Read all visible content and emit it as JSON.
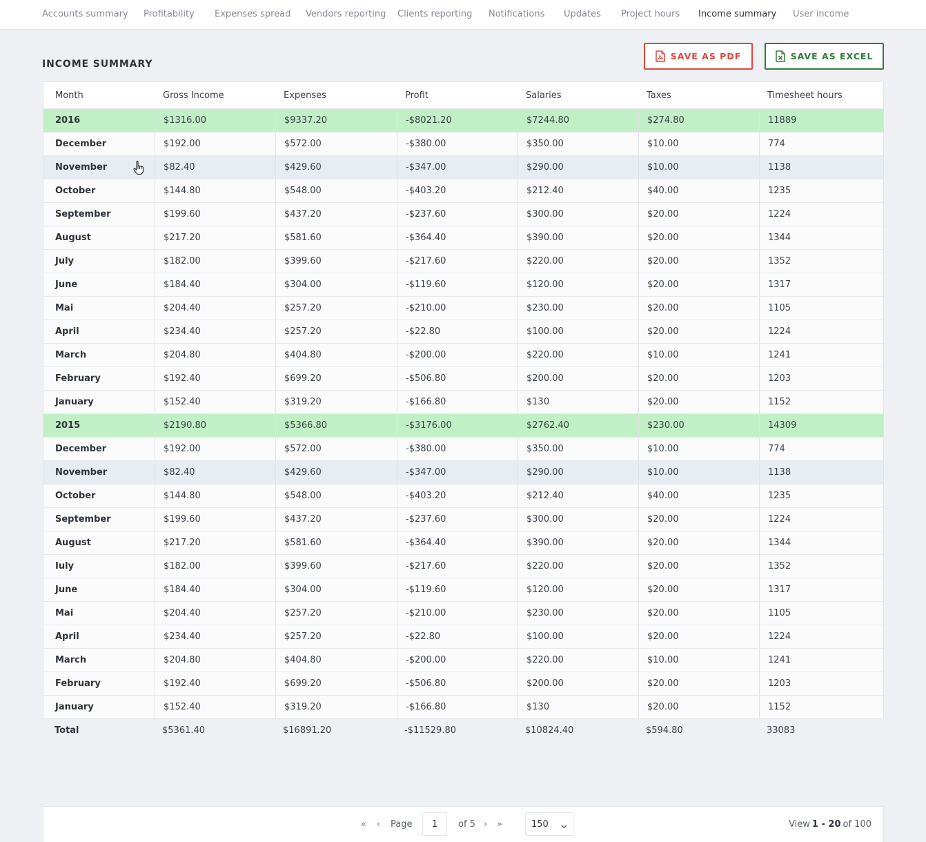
{
  "nav": {
    "tabs": [
      {
        "label": "Accounts summary"
      },
      {
        "label": "Profitability"
      },
      {
        "label": "Expenses spread"
      },
      {
        "label": "Vendors reporting"
      },
      {
        "label": "Clients reporting"
      },
      {
        "label": "Notifications"
      },
      {
        "label": "Updates"
      },
      {
        "label": "Project hours"
      },
      {
        "label": "Income summary"
      },
      {
        "label": "User income"
      }
    ],
    "active_tab": "Income summary"
  },
  "page": {
    "title": "INCOME SUMMARY",
    "save_pdf_label": "SAVE AS PDF",
    "save_excel_label": "SAVE AS EXCEL"
  },
  "colors": {
    "year_row": "#c1f0c6",
    "pdf_accent": "#e2453b",
    "excel_accent": "#2e7d3c"
  },
  "table": {
    "columns": [
      "Month",
      "Gross Income",
      "Expenses",
      "Profit",
      "Salaries",
      "Taxes",
      "Timesheet hours"
    ],
    "rows": [
      {
        "type": "year",
        "cells": [
          "2016",
          "$1316.00",
          "$9337.20",
          "-$8021.20",
          "$7244.80",
          "$274.80",
          "11889"
        ]
      },
      {
        "type": "month",
        "cells": [
          "December",
          "$192.00",
          "$572.00",
          "-$380.00",
          "$350.00",
          "$10.00",
          "774"
        ]
      },
      {
        "type": "month",
        "hover": true,
        "cells": [
          "November",
          "$82.40",
          "$429.60",
          "-$347.00",
          "$290.00",
          "$10.00",
          "1138"
        ]
      },
      {
        "type": "month",
        "cells": [
          "October",
          "$144.80",
          "$548.00",
          "-$403.20",
          "$212.40",
          "$40.00",
          "1235"
        ]
      },
      {
        "type": "month",
        "cells": [
          "September",
          "$199.60",
          "$437.20",
          "-$237.60",
          "$300.00",
          "$20.00",
          "1224"
        ]
      },
      {
        "type": "month",
        "cells": [
          "August",
          "$217.20",
          "$581.60",
          "-$364.40",
          "$390.00",
          "$20.00",
          "1344"
        ]
      },
      {
        "type": "month",
        "cells": [
          "July",
          "$182.00",
          "$399.60",
          "-$217.60",
          "$220.00",
          "$20.00",
          "1352"
        ]
      },
      {
        "type": "month",
        "cells": [
          "June",
          "$184.40",
          "$304.00",
          "-$119.60",
          "$120.00",
          "$20.00",
          "1317"
        ]
      },
      {
        "type": "month",
        "cells": [
          "Mai",
          "$204.40",
          "$257.20",
          "-$210.00",
          "$230.00",
          "$20.00",
          "1105"
        ]
      },
      {
        "type": "month",
        "cells": [
          "April",
          "$234.40",
          "$257.20",
          "-$22.80",
          "$100.00",
          "$20.00",
          "1224"
        ]
      },
      {
        "type": "month",
        "cells": [
          "March",
          "$204.80",
          "$404.80",
          "-$200.00",
          "$220.00",
          "$10.00",
          "1241"
        ]
      },
      {
        "type": "month",
        "cells": [
          "February",
          "$192.40",
          "$699.20",
          "-$506.80",
          "$200.00",
          "$20.00",
          "1203"
        ]
      },
      {
        "type": "month",
        "cells": [
          "January",
          "$152.40",
          "$319.20",
          "-$166.80",
          "$130",
          "$20.00",
          "1152"
        ]
      },
      {
        "type": "year",
        "cells": [
          "2015",
          "$2190.80",
          "$5366.80",
          "-$3176.00",
          "$2762.40",
          "$230.00",
          "14309"
        ]
      },
      {
        "type": "month",
        "cells": [
          "December",
          "$192.00",
          "$572.00",
          "-$380.00",
          "$350.00",
          "$10.00",
          "774"
        ]
      },
      {
        "type": "month",
        "hover": true,
        "cells": [
          "November",
          "$82.40",
          "$429.60",
          "-$347.00",
          "$290.00",
          "$10.00",
          "1138"
        ]
      },
      {
        "type": "month",
        "cells": [
          "October",
          "$144.80",
          "$548.00",
          "-$403.20",
          "$212.40",
          "$40.00",
          "1235"
        ]
      },
      {
        "type": "month",
        "cells": [
          "September",
          "$199.60",
          "$437.20",
          "-$237.60",
          "$300.00",
          "$20.00",
          "1224"
        ]
      },
      {
        "type": "month",
        "cells": [
          "August",
          "$217.20",
          "$581.60",
          "-$364.40",
          "$390.00",
          "$20.00",
          "1344"
        ]
      },
      {
        "type": "month",
        "cells": [
          "Iuly",
          "$182.00",
          "$399.60",
          "-$217.60",
          "$220.00",
          "$20.00",
          "1352"
        ]
      },
      {
        "type": "month",
        "cells": [
          "June",
          "$184.40",
          "$304.00",
          "-$119.60",
          "$120.00",
          "$20.00",
          "1317"
        ]
      },
      {
        "type": "month",
        "cells": [
          "Mai",
          "$204.40",
          "$257.20",
          "-$210.00",
          "$230.00",
          "$20.00",
          "1105"
        ]
      },
      {
        "type": "month",
        "cells": [
          "April",
          "$234.40",
          "$257.20",
          "-$22.80",
          "$100.00",
          "$20.00",
          "1224"
        ]
      },
      {
        "type": "month",
        "cells": [
          "March",
          "$204.80",
          "$404.80",
          "-$200.00",
          "$220.00",
          "$10.00",
          "1241"
        ]
      },
      {
        "type": "month",
        "cells": [
          "February",
          "$192.40",
          "$699.20",
          "-$506.80",
          "$200.00",
          "$20.00",
          "1203"
        ]
      },
      {
        "type": "month",
        "cells": [
          "January",
          "$152.40",
          "$319.20",
          "-$166.80",
          "$130",
          "$20.00",
          "1152"
        ]
      }
    ],
    "total": [
      "Total",
      "$5361.40",
      "$16891.20",
      "-$11529.80",
      "$10824.40",
      "$594.80",
      "33083"
    ]
  },
  "pager": {
    "first_icon": "double-chevron-left-icon",
    "prev_icon": "chevron-left-icon",
    "next_icon": "chevron-right-icon",
    "last_icon": "double-chevron-right-icon",
    "page_label": "Page",
    "current_page": "1",
    "of_label": "of 5",
    "per_page": "150",
    "view_prefix": "View",
    "view_range": "1 - 20",
    "view_suffix": "of 100"
  }
}
